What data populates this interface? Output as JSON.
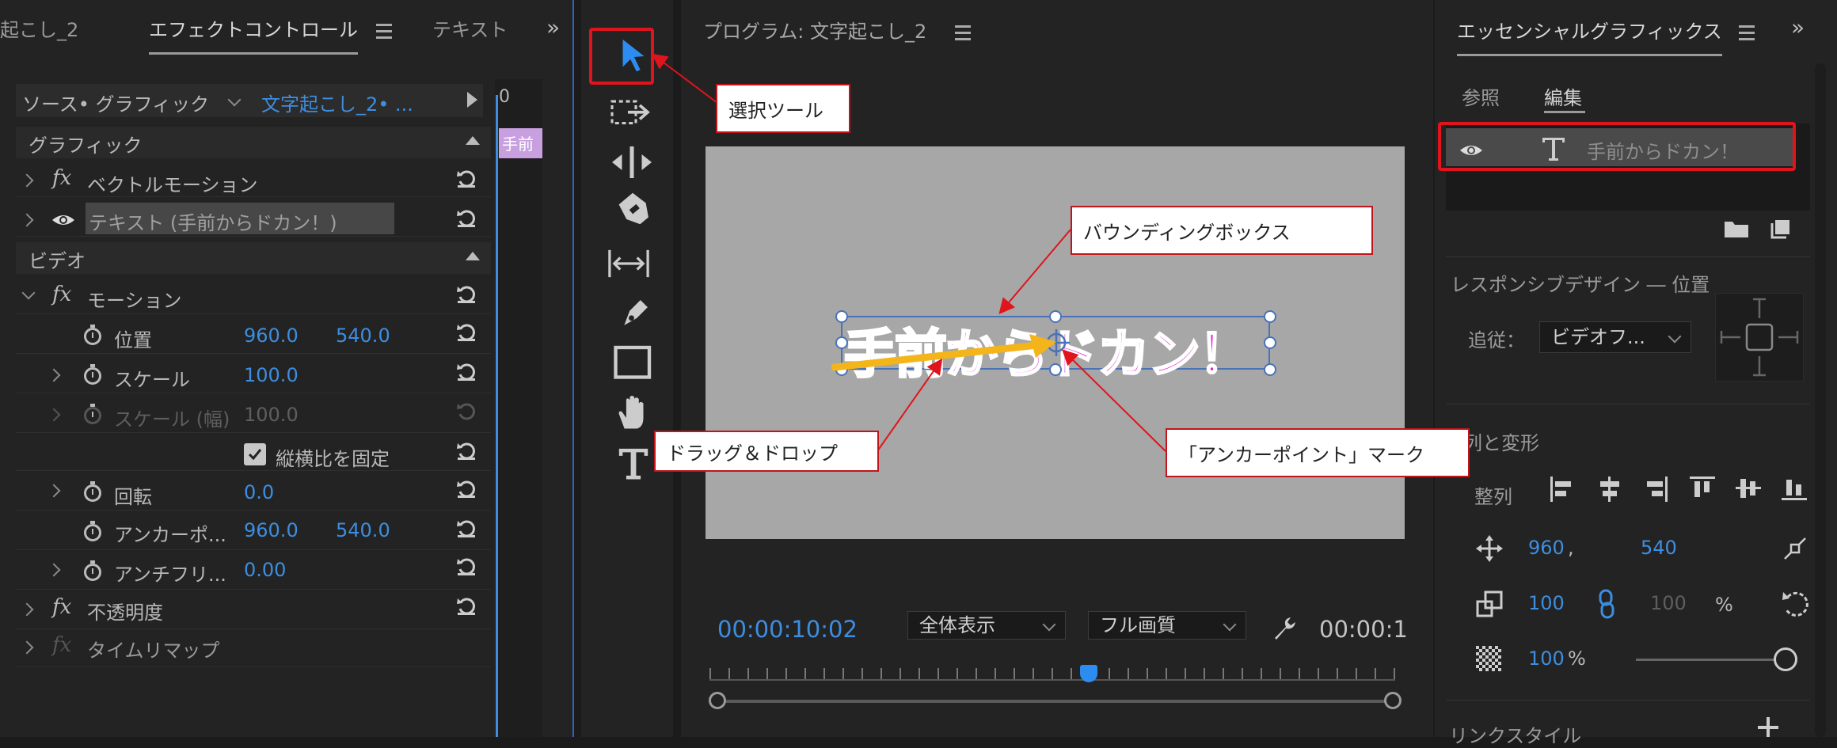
{
  "left_panel": {
    "tabs": [
      "起こし_2",
      "エフェクトコントロール",
      "テキスト"
    ],
    "source_label": "ソース• グラフィック",
    "source_clip": "文字起こし_2• ...",
    "timeline_ruler_label": "0",
    "clip_label": "手前",
    "sections": {
      "graphic": "グラフィック",
      "video": "ビデオ"
    },
    "effects": {
      "vector_motion": "ベクトルモーション",
      "text_layer": "テキスト (手前からドカン！)",
      "motion": "モーション",
      "opacity": "不透明度",
      "time_remap": "タイムリマップ"
    },
    "properties": {
      "position": {
        "label": "位置",
        "x": "960.0",
        "y": "540.0"
      },
      "scale": {
        "label": "スケール",
        "value": "100.0"
      },
      "scale_width": {
        "label": "スケール (幅)",
        "value": "100.0"
      },
      "uniform_scale": "縦横比を固定",
      "rotation": {
        "label": "回転",
        "value": "0.0"
      },
      "anchor_point": {
        "label": "アンカーポ...",
        "x": "960.0",
        "y": "540.0"
      },
      "anti_flicker": {
        "label": "アンチフリ...",
        "value": "0.00"
      }
    }
  },
  "program_monitor": {
    "title": "プログラム: 文字起こし_2",
    "canvas_text": "手前からドカン！",
    "timecode": "00:00:10:02",
    "zoom": "全体表示",
    "quality": "フル画質",
    "end_timecode": "00:00:1"
  },
  "essential_graphics": {
    "title": "エッセンシャルグラフィックス",
    "tabs": [
      "参照",
      "編集"
    ],
    "layer_name": "手前からドカン！",
    "responsive_label": "レスポンシブデザイン ― 位置",
    "follow_label": "追従：",
    "follow_value": "ビデオフ...",
    "align_section": "列と変形",
    "align_label": "整列",
    "position": {
      "x": "960",
      "sep": ",",
      "y": "540"
    },
    "scale": {
      "value": "100",
      "locked_value": "100",
      "unit": "%"
    },
    "opacity": {
      "value": "100",
      "unit": "%"
    },
    "link_style": "リンクスタイル"
  },
  "callouts": {
    "select_tool": "選択ツール",
    "bounding_box": "バウンディングボックス",
    "drag_drop": "ドラッグ＆ドロップ",
    "anchor_mark": "「アンカーポイント」マーク"
  },
  "colors": {
    "accent_blue": "#3d8ee0",
    "callout_red": "#e0141d",
    "canvas_text": "#e020d0",
    "drag_arrow": "#f3b519"
  }
}
